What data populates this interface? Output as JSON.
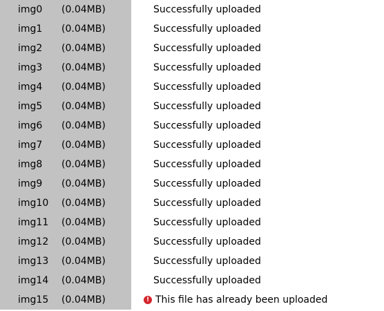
{
  "colors": {
    "info_panel_bg": "#c2c2c2",
    "error_icon": "#d4262c"
  },
  "rows": [
    {
      "name": "img0",
      "size": "(0.04MB)",
      "status": "Successfully uploaded",
      "error": false
    },
    {
      "name": "img1",
      "size": "(0.04MB)",
      "status": "Successfully uploaded",
      "error": false
    },
    {
      "name": "img2",
      "size": "(0.04MB)",
      "status": "Successfully uploaded",
      "error": false
    },
    {
      "name": "img3",
      "size": "(0.04MB)",
      "status": "Successfully uploaded",
      "error": false
    },
    {
      "name": "img4",
      "size": "(0.04MB)",
      "status": "Successfully uploaded",
      "error": false
    },
    {
      "name": "img5",
      "size": "(0.04MB)",
      "status": "Successfully uploaded",
      "error": false
    },
    {
      "name": "img6",
      "size": "(0.04MB)",
      "status": "Successfully uploaded",
      "error": false
    },
    {
      "name": "img7",
      "size": "(0.04MB)",
      "status": "Successfully uploaded",
      "error": false
    },
    {
      "name": "img8",
      "size": "(0.04MB)",
      "status": "Successfully uploaded",
      "error": false
    },
    {
      "name": "img9",
      "size": "(0.04MB)",
      "status": "Successfully uploaded",
      "error": false
    },
    {
      "name": "img10",
      "size": "(0.04MB)",
      "status": "Successfully uploaded",
      "error": false
    },
    {
      "name": "img11",
      "size": "(0.04MB)",
      "status": "Successfully uploaded",
      "error": false
    },
    {
      "name": "img12",
      "size": "(0.04MB)",
      "status": "Successfully uploaded",
      "error": false
    },
    {
      "name": "img13",
      "size": "(0.04MB)",
      "status": "Successfully uploaded",
      "error": false
    },
    {
      "name": "img14",
      "size": "(0.04MB)",
      "status": "Successfully uploaded",
      "error": false
    },
    {
      "name": "img15",
      "size": "(0.04MB)",
      "status": "This file has already been uploaded",
      "error": true
    }
  ]
}
